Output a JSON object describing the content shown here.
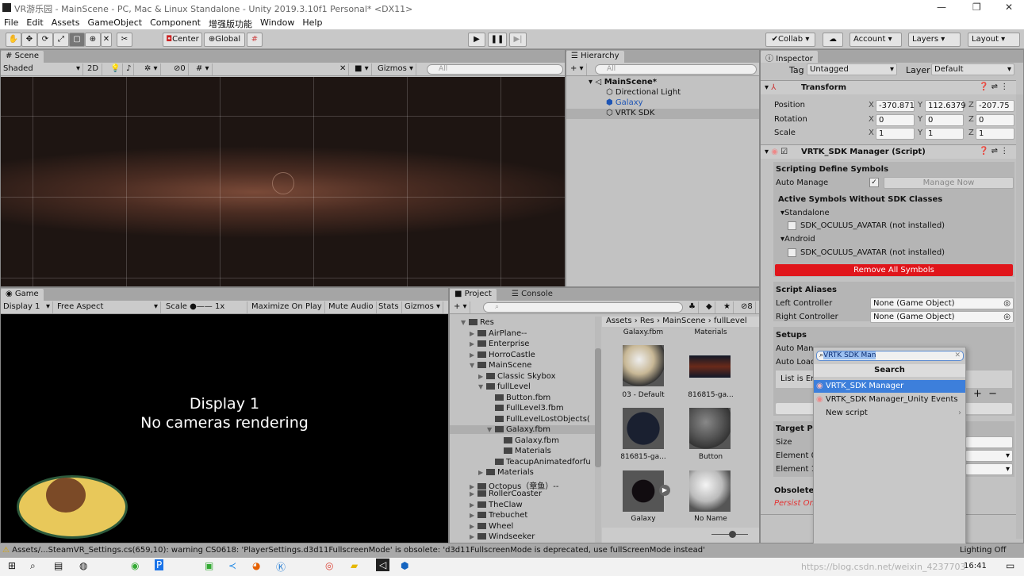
{
  "window": {
    "title": "VR游乐园 - MainScene - PC, Mac & Linux Standalone - Unity 2019.3.10f1 Personal* <DX11>"
  },
  "menu": [
    "File",
    "Edit",
    "Assets",
    "GameObject",
    "Component",
    "增强版功能",
    "Window",
    "Help"
  ],
  "toolbar": {
    "center": "Center",
    "global": "Global",
    "collab": "Collab",
    "account": "Account",
    "layers": "Layers",
    "layout": "Layout"
  },
  "scene": {
    "tab": "Scene",
    "shading": "Shaded",
    "mode2d": "2D",
    "hidden_count": "0",
    "gizmos": "Gizmos",
    "search_placeholder": "All"
  },
  "hierarchy": {
    "tab": "Hierarchy",
    "search_placeholder": "All",
    "scene": "MainScene*",
    "items": [
      "Directional Light",
      "Galaxy",
      "VRTK SDK"
    ]
  },
  "game": {
    "tab": "Game",
    "display": "Display 1",
    "aspect": "Free Aspect",
    "scale_label": "Scale",
    "scale_value": "1x",
    "maximize": "Maximize On Play",
    "mute": "Mute Audio",
    "stats": "Stats",
    "gizmos": "Gizmos",
    "overlay_line1": "Display 1",
    "overlay_line2": "No cameras rendering"
  },
  "project": {
    "tab": "Project",
    "console_tab": "Console",
    "hidden_count": "8",
    "tree": [
      {
        "label": "Res",
        "depth": 0,
        "open": true
      },
      {
        "label": "AirPlane--",
        "depth": 1
      },
      {
        "label": "Enterprise",
        "depth": 1
      },
      {
        "label": "HorroCastle",
        "depth": 1
      },
      {
        "label": "MainScene",
        "depth": 1,
        "open": true
      },
      {
        "label": "Classic Skybox",
        "depth": 2
      },
      {
        "label": "fullLevel",
        "depth": 2,
        "open": true
      },
      {
        "label": "Button.fbm",
        "depth": 3,
        "leaf": true
      },
      {
        "label": "FullLevel3.fbm",
        "depth": 3,
        "leaf": true
      },
      {
        "label": "FullLevelLostObjects(",
        "depth": 3,
        "leaf": true
      },
      {
        "label": "Galaxy.fbm",
        "depth": 3,
        "open": true,
        "selected": true
      },
      {
        "label": "Galaxy.fbm",
        "depth": 4,
        "leaf": true
      },
      {
        "label": "Materials",
        "depth": 4,
        "leaf": true
      },
      {
        "label": "TeacupAnimatedforfu",
        "depth": 3,
        "leaf": true
      },
      {
        "label": "Materials",
        "depth": 2
      },
      {
        "label": "Octopus（章鱼）--",
        "depth": 1
      },
      {
        "label": "RollerCoaster",
        "depth": 1
      },
      {
        "label": "TheClaw",
        "depth": 1
      },
      {
        "label": "Trebuchet",
        "depth": 1
      },
      {
        "label": "Wheel",
        "depth": 1
      },
      {
        "label": "Windseeker",
        "depth": 1
      }
    ],
    "breadcrumb": [
      "Assets",
      "Res",
      "MainScene",
      "fullLevel"
    ],
    "top_labels": [
      "Galaxy.fbm",
      "Materials"
    ],
    "assets": [
      "03 - Default",
      "816815-ga...",
      "816815-ga...",
      "Button",
      "Galaxy",
      "No Name"
    ]
  },
  "inspector": {
    "tab": "Inspector",
    "tag_label": "Tag",
    "tag": "Untagged",
    "layer_label": "Layer",
    "layer": "Default",
    "transform": {
      "title": "Transform",
      "rows": [
        {
          "label": "Position",
          "x": "-370.871",
          "y": "112.6379",
          "z": "-207.75"
        },
        {
          "label": "Rotation",
          "x": "0",
          "y": "0",
          "z": "0"
        },
        {
          "label": "Scale",
          "x": "1",
          "y": "1",
          "z": "1"
        }
      ]
    },
    "script": {
      "title": "VRTK_SDK Manager (Script)",
      "sds": "Scripting Define Symbols",
      "auto_manage": "Auto Manage",
      "manage_now": "Manage Now",
      "active_symbols": "Active Symbols Without SDK Classes",
      "standalone": "Standalone",
      "android": "Android",
      "symbol": "SDK_OCULUS_AVATAR (not installed)",
      "remove_all": "Remove All Symbols",
      "aliases": "Script Aliases",
      "left": "Left Controller",
      "right": "Right Controller",
      "none_go": "None (Game Object)",
      "setups": "Setups",
      "auto_man": "Auto Man",
      "auto_load": "Auto Load",
      "list_empty": "List is En",
      "target": "Target Pl",
      "size": "Size",
      "el0": "Element 0",
      "el1": "Element 1",
      "obsolete": "Obsolete :",
      "persist": "Persist On"
    }
  },
  "popup": {
    "query": "VRTK SDK Man",
    "header": "Search",
    "items": [
      "VRTK_SDK Manager",
      "VRTK_SDK Manager_Unity Events"
    ],
    "new_script": "New script"
  },
  "status": {
    "message": "Assets/...SteamVR_Settings.cs(659,10): warning CS0618: 'PlayerSettings.d3d11FullscreenMode' is obsolete: 'd3d11FullscreenMode is deprecated, use fullScreenMode instead'",
    "lighting": "Lighting Off"
  },
  "taskbar": {
    "time": "16:41",
    "watermark": "https://blog.csdn.net/weixin_4237703"
  },
  "colors": {
    "accent": "#3d7fdb",
    "remove_button": "#e0151b",
    "persist_red": "#e53030"
  }
}
